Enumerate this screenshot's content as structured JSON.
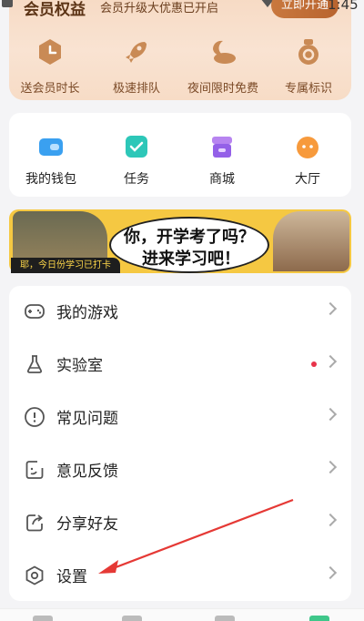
{
  "status": {
    "time": "1:45"
  },
  "vip": {
    "title": "会员权益",
    "subtitle": "会员升级大优惠已开启",
    "button": "立即开通",
    "items": [
      {
        "label": "送会员时长",
        "icon": "clock-icon"
      },
      {
        "label": "极速排队",
        "icon": "rocket-icon"
      },
      {
        "label": "夜间限时免费",
        "icon": "moon-cloud-icon"
      },
      {
        "label": "专属标识",
        "icon": "badge-icon"
      }
    ]
  },
  "quick": {
    "items": [
      {
        "label": "我的钱包",
        "icon": "wallet-icon"
      },
      {
        "label": "任务",
        "icon": "task-icon"
      },
      {
        "label": "商城",
        "icon": "shop-icon"
      },
      {
        "label": "大厅",
        "icon": "lobby-icon"
      }
    ]
  },
  "banner": {
    "line1": "你，开学考了吗？",
    "line2": "进来学习吧！",
    "tag": "耶，今日份学习已打卡"
  },
  "menu": {
    "items": [
      {
        "label": "我的游戏",
        "icon": "gamepad-icon"
      },
      {
        "label": "实验室",
        "icon": "flask-icon"
      },
      {
        "label": "常见问题",
        "icon": "info-icon"
      },
      {
        "label": "意见反馈",
        "icon": "feedback-icon"
      },
      {
        "label": "分享好友",
        "icon": "share-icon"
      },
      {
        "label": "设置",
        "icon": "settings-icon"
      }
    ]
  },
  "colors": {
    "accent": "#e8334a",
    "vip_brown": "#b8642f",
    "arrow": "#e53935"
  }
}
